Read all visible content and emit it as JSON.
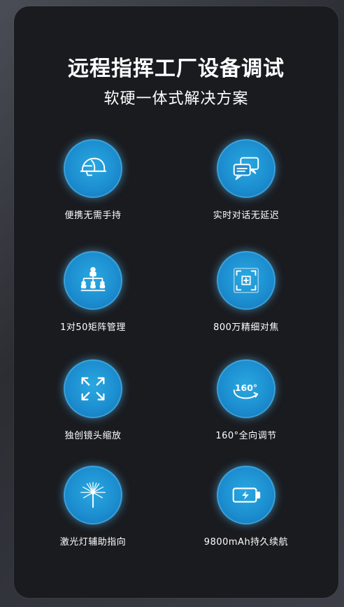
{
  "header": {
    "title": "远程指挥工厂设备调试",
    "subtitle": "软硬一体式解决方案"
  },
  "features": [
    {
      "label": "便携无需手持",
      "icon": "helmet-icon"
    },
    {
      "label": "实时对话无延迟",
      "icon": "chat-bubbles-icon"
    },
    {
      "label": "1对50矩阵管理",
      "icon": "org-chart-icon"
    },
    {
      "label": "800万精细对焦",
      "icon": "focus-target-icon"
    },
    {
      "label": "独创镜头缩放",
      "icon": "expand-arrows-icon"
    },
    {
      "label": "160°全向调节",
      "icon": "rotate-160-icon",
      "icon_text": "160°"
    },
    {
      "label": "激光灯辅助指向",
      "icon": "laser-burst-icon"
    },
    {
      "label": "9800mAh持久续航",
      "icon": "battery-icon"
    }
  ],
  "colors": {
    "card_background": "#1a1b1f",
    "icon_circle": "#1c8ed0",
    "text": "#ffffff"
  }
}
